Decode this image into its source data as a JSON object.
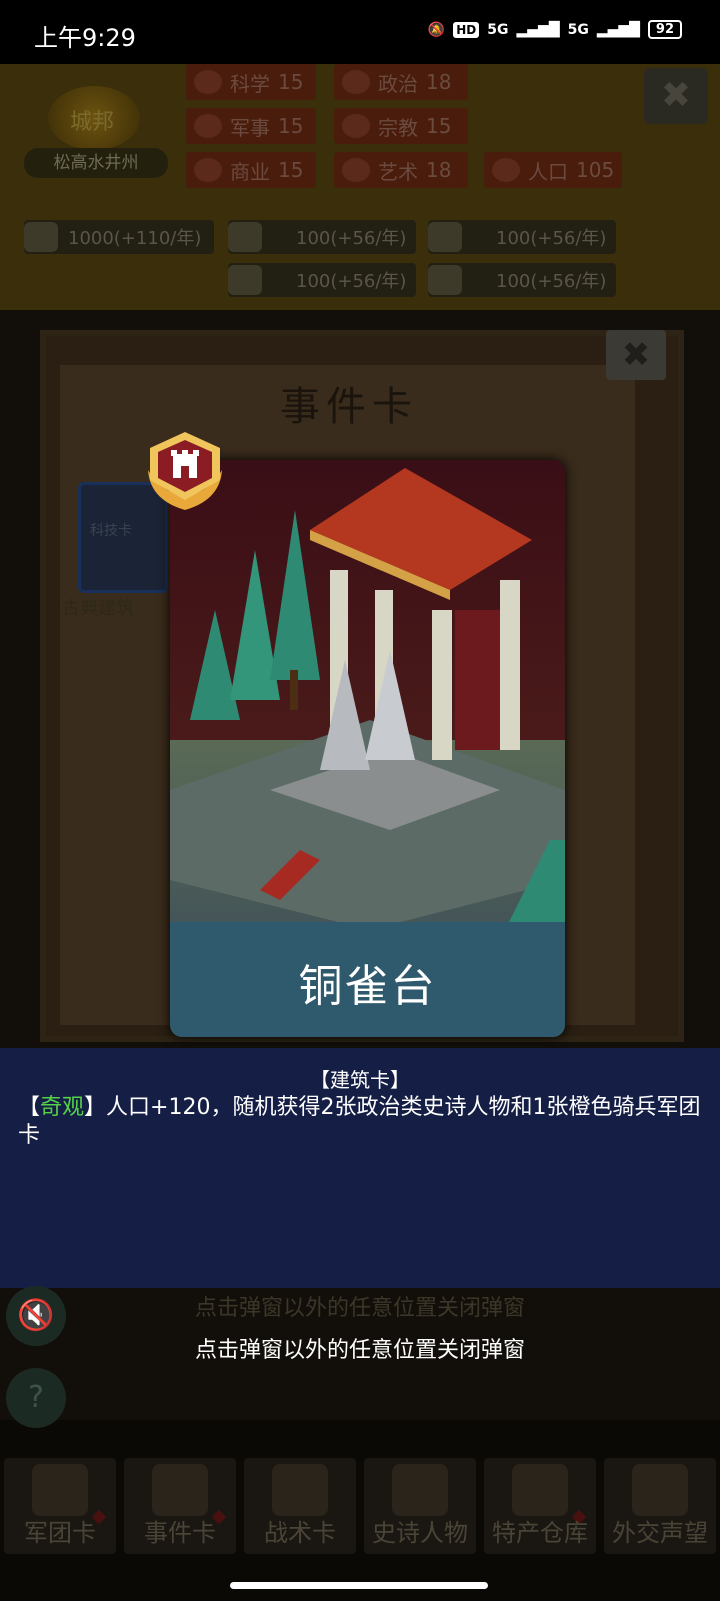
{
  "status_bar": {
    "time": "上午9:29",
    "network_1": "5G",
    "network_2": "5G",
    "hd": "HD",
    "battery": "92"
  },
  "header": {
    "emblem_text": "城邦",
    "city_name": "松高水井州",
    "stats": [
      {
        "label": "科学",
        "value": "15",
        "icon": "planet-icon"
      },
      {
        "label": "政治",
        "value": "18",
        "icon": "bank-icon"
      },
      {
        "label": "军事",
        "value": "15",
        "icon": "crossed-swords-icon"
      },
      {
        "label": "宗教",
        "value": "15",
        "icon": "cross-icon"
      },
      {
        "label": "商业",
        "value": "15",
        "icon": "scales-icon"
      },
      {
        "label": "艺术",
        "value": "18",
        "icon": "lotus-icon"
      },
      {
        "label": "人口",
        "value": "105",
        "icon": "person-icon"
      }
    ],
    "resources": [
      {
        "value": "1000(+110/年)",
        "icon": "gold-coins-icon"
      },
      {
        "value": "100(+56/年)",
        "icon": "wood-icon"
      },
      {
        "value": "100(+56/年)",
        "icon": "iron-icon"
      },
      {
        "value": "100(+56/年)",
        "icon": "stone-icon"
      },
      {
        "value": "100(+56/年)",
        "icon": "meat-icon"
      }
    ],
    "close_symbol": "✖"
  },
  "panel": {
    "title": "事件卡",
    "close_symbol": "✖",
    "tech_card_label": "科技卡",
    "card_name_bg": "古典建筑"
  },
  "card": {
    "title": "铜雀台",
    "badge_icon": "castle-tower-badge-icon"
  },
  "description": {
    "type": "【建筑卡】",
    "bracket_open": "【",
    "tag": "奇观",
    "bracket_close": "】",
    "text": "人口+120，随机获得2张政治类史诗人物和1张橙色骑兵军团卡"
  },
  "hints": {
    "close_hint_bg": "点击弹窗以外的任意位置关闭弹窗",
    "close_hint": "点击弹窗以外的任意位置关闭弹窗"
  },
  "side_buttons": {
    "mute_symbol": "🔇",
    "help_symbol": "?"
  },
  "bottom_nav": [
    {
      "label": "军团卡",
      "icon": "helmet-icon",
      "dot": true
    },
    {
      "label": "事件卡",
      "icon": "scroll-icon",
      "dot": true
    },
    {
      "label": "战术卡",
      "icon": "tactics-icon",
      "dot": false
    },
    {
      "label": "史诗人物",
      "icon": "crown-icon",
      "dot": false
    },
    {
      "label": "特产仓库",
      "icon": "chest-icon",
      "dot": true
    },
    {
      "label": "外交声望",
      "icon": "envelope-icon",
      "dot": false
    }
  ],
  "colors": {
    "tag_green": "#55d24a",
    "desc_bg": "#151f45",
    "card_band": "#2f5a6d"
  }
}
